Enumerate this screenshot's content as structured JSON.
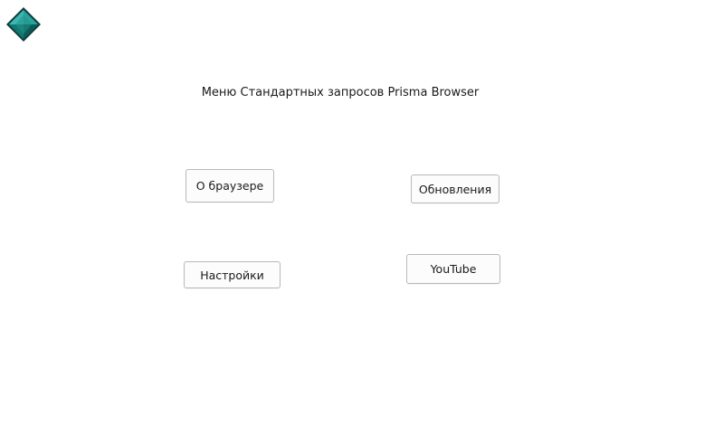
{
  "app": {
    "logo_icon": "teal-diamond-icon"
  },
  "menu": {
    "title": "Меню Стандартных запросов Prisma Browser",
    "buttons": {
      "about": "О браузере",
      "updates": "Обновления",
      "settings": "Настройки",
      "youtube": "YouTube"
    }
  },
  "colors": {
    "logo_light": "#3fb7b0",
    "logo_mid": "#1c8c86",
    "logo_dark": "#0e5a57",
    "button_border": "#b9b9b9",
    "button_bg": "#fcfcfc"
  }
}
